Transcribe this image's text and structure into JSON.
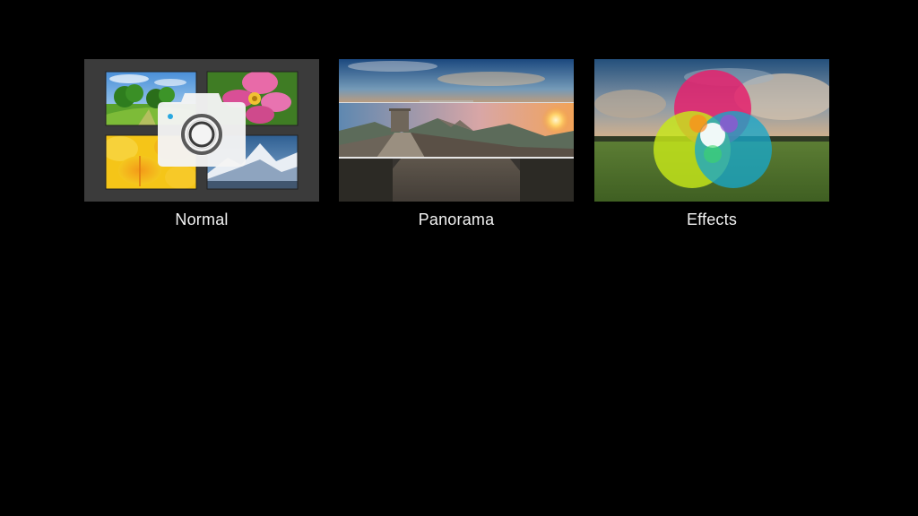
{
  "modes": [
    {
      "label": "Normal",
      "icon": "camera-icon"
    },
    {
      "label": "Panorama",
      "icon": "panorama-icon"
    },
    {
      "label": "Effects",
      "icon": "effects-icon"
    }
  ],
  "colors": {
    "background": "#000000",
    "label_text": "#f2f2f2",
    "normal_tile_bg": "#3b3b3b",
    "camera_dot": "#29a8e0"
  }
}
